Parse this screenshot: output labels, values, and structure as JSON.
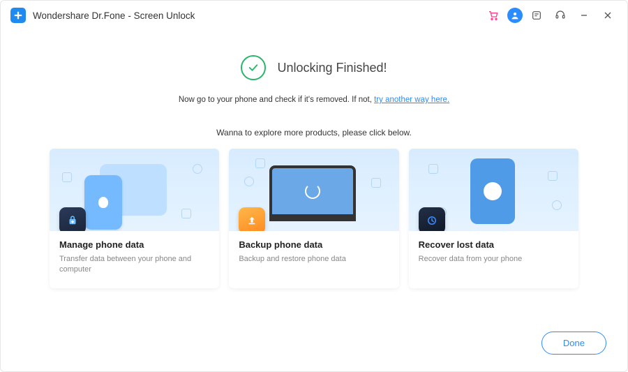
{
  "titlebar": {
    "app_title": "Wondershare Dr.Fone - Screen Unlock"
  },
  "hero": {
    "title": "Unlocking Finished!",
    "sub_prefix": "Now go to your phone and check if it's removed. If not, ",
    "link_text": "try another way here."
  },
  "explore_text": "Wanna to explore more products,  please click below.",
  "cards": [
    {
      "title": "Manage phone data",
      "desc": "Transfer data between your phone and computer"
    },
    {
      "title": "Backup phone data",
      "desc": "Backup and restore phone data"
    },
    {
      "title": "Recover lost data",
      "desc": "Recover data from your phone"
    }
  ],
  "done_label": "Done"
}
